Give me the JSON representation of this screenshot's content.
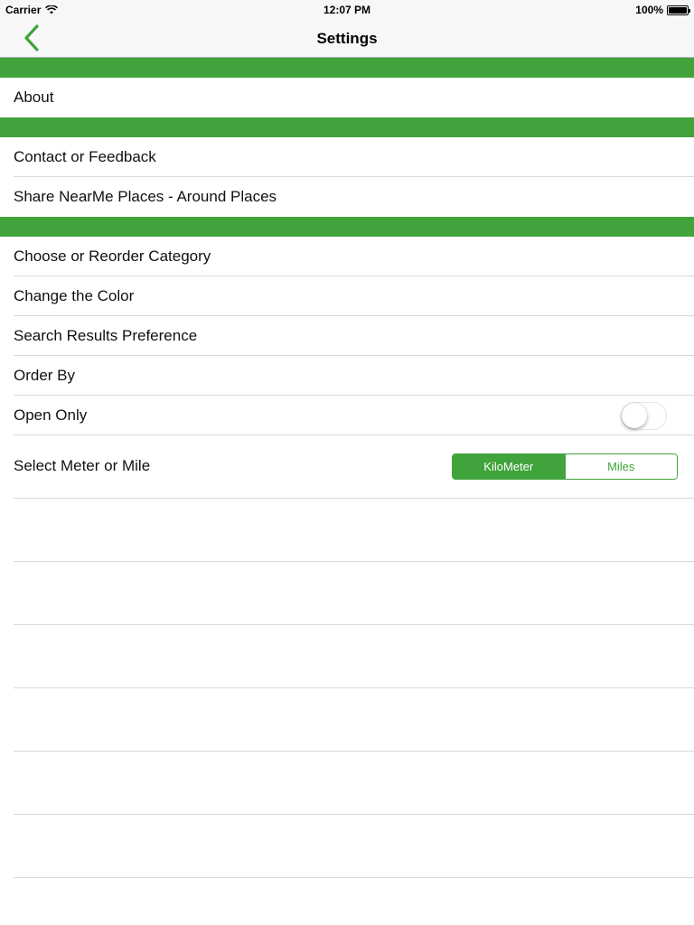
{
  "status_bar": {
    "carrier": "Carrier",
    "time": "12:07 PM",
    "battery": "100%"
  },
  "nav": {
    "title": "Settings",
    "back_icon": "chevron-left-icon"
  },
  "colors": {
    "accent": "#41a33b",
    "separator": "#d9d9d9"
  },
  "sections": [
    {
      "items": [
        {
          "label": "About"
        }
      ]
    },
    {
      "items": [
        {
          "label": "Contact or Feedback"
        },
        {
          "label": "Share NearMe Places - Around Places"
        }
      ]
    },
    {
      "items": [
        {
          "label": "Choose or Reorder Category"
        },
        {
          "label": "Change the Color"
        },
        {
          "label": "Search Results Preference"
        },
        {
          "label": "Order By"
        },
        {
          "label": "Open Only",
          "toggle": false
        },
        {
          "label": "Select Meter or Mile"
        }
      ]
    }
  ],
  "unit_selector": {
    "options": [
      "KiloMeter",
      "Miles"
    ],
    "selected": "KiloMeter"
  }
}
